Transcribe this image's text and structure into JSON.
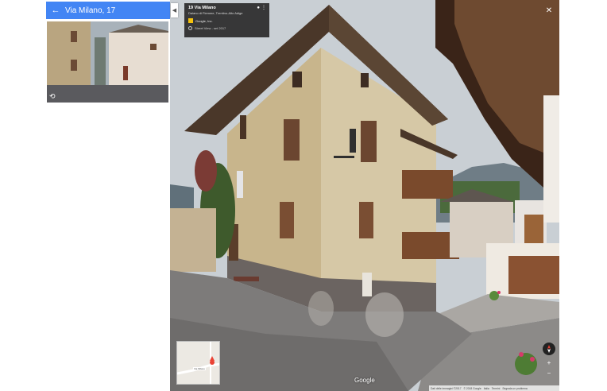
{
  "left_panel": {
    "title": "Via Milano, 17",
    "back_icon": "arrow-left-icon",
    "thumb_icon": "rotate-icon",
    "header_color": "#4285f4"
  },
  "collapse_icon": "chevron-left-icon",
  "info_card": {
    "title": "19 Via Milano",
    "subtitle": "Daiano di Fiemme, Trentino-Alto Adige",
    "owner": "Google, Inc.",
    "sv_date": "Street View - set 2017"
  },
  "close_icon": "close-icon",
  "minimap_label": "Via Milano",
  "controls": {
    "zoom_in": "+",
    "zoom_out": "−"
  },
  "google_logo": "Google",
  "footer": {
    "items": [
      "Dati delle immagini ©2017",
      "© 2018 Google",
      "Italia",
      "Termini",
      "Segnala un problema"
    ]
  }
}
